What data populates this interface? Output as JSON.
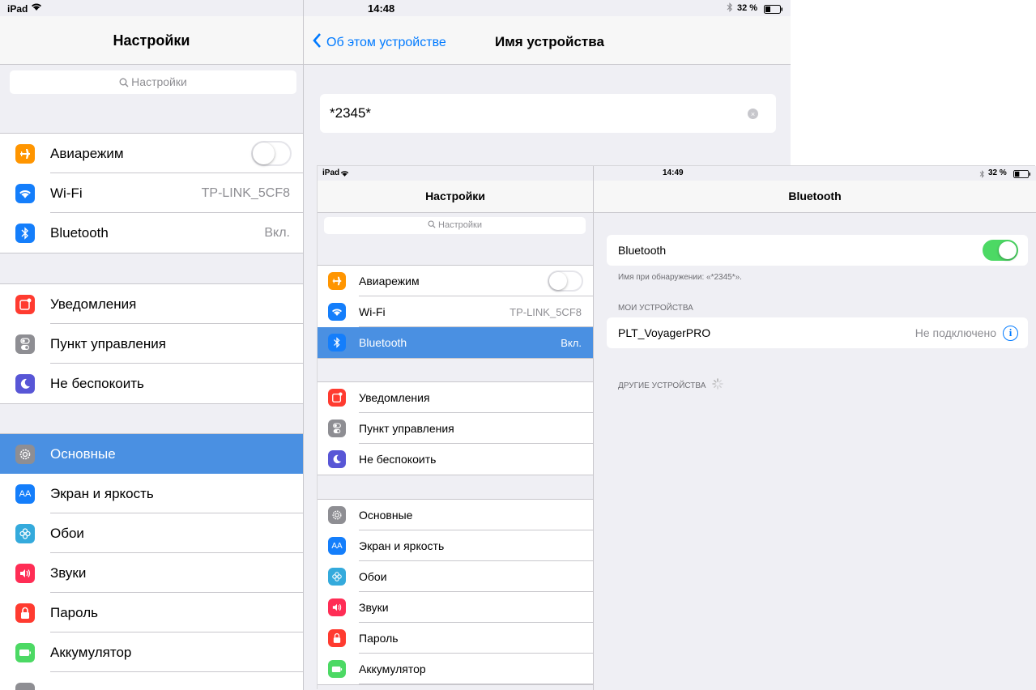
{
  "screenshot1": {
    "status": {
      "device": "iPad",
      "time": "14:48",
      "battery": "32 %"
    },
    "sidebar": {
      "title": "Настройки",
      "search_placeholder": "Настройки",
      "group1": [
        {
          "label": "Авиарежим",
          "value": "",
          "icon": "airplane-icon",
          "color": "#ff9500"
        },
        {
          "label": "Wi-Fi",
          "value": "TP-LINK_5CF8",
          "icon": "wifi-icon",
          "color": "#147efb"
        },
        {
          "label": "Bluetooth",
          "value": "Вкл.",
          "icon": "bluetooth-icon",
          "color": "#147efb"
        }
      ],
      "group2": [
        {
          "label": "Уведомления",
          "icon": "notifications-icon",
          "color": "#ff3b30"
        },
        {
          "label": "Пункт управления",
          "icon": "control-center-icon",
          "color": "#8e8e93"
        },
        {
          "label": "Не беспокоить",
          "icon": "moon-icon",
          "color": "#5856d6"
        }
      ],
      "group3": [
        {
          "label": "Основные",
          "icon": "gear-icon",
          "color": "#8e8e93",
          "selected": true
        },
        {
          "label": "Экран и яркость",
          "icon": "display-icon",
          "color": "#147efb"
        },
        {
          "label": "Обои",
          "icon": "wallpaper-icon",
          "color": "#34aadc"
        },
        {
          "label": "Звуки",
          "icon": "sound-icon",
          "color": "#ff2d55"
        },
        {
          "label": "Пароль",
          "icon": "lock-icon",
          "color": "#ff3b30"
        },
        {
          "label": "Аккумулятор",
          "icon": "battery-icon",
          "color": "#4cd964"
        }
      ]
    },
    "detail": {
      "back_label": "Об этом устройстве",
      "title": "Имя устройства",
      "device_name_value": "*2345*"
    }
  },
  "screenshot2": {
    "status": {
      "device": "iPad",
      "time": "14:49",
      "battery": "32 %"
    },
    "sidebar": {
      "title": "Настройки",
      "search_placeholder": "Настройки",
      "group1": [
        {
          "label": "Авиарежим",
          "value": "",
          "icon": "airplane-icon",
          "color": "#ff9500"
        },
        {
          "label": "Wi-Fi",
          "value": "TP-LINK_5CF8",
          "icon": "wifi-icon",
          "color": "#147efb"
        },
        {
          "label": "Bluetooth",
          "value": "Вкл.",
          "icon": "bluetooth-icon",
          "color": "#147efb",
          "selected": true
        }
      ],
      "group2": [
        {
          "label": "Уведомления",
          "icon": "notifications-icon",
          "color": "#ff3b30"
        },
        {
          "label": "Пункт управления",
          "icon": "control-center-icon",
          "color": "#8e8e93"
        },
        {
          "label": "Не беспокоить",
          "icon": "moon-icon",
          "color": "#5856d6"
        }
      ],
      "group3": [
        {
          "label": "Основные",
          "icon": "gear-icon",
          "color": "#8e8e93"
        },
        {
          "label": "Экран и яркость",
          "icon": "display-icon",
          "color": "#147efb"
        },
        {
          "label": "Обои",
          "icon": "wallpaper-icon",
          "color": "#34aadc"
        },
        {
          "label": "Звуки",
          "icon": "sound-icon",
          "color": "#ff2d55"
        },
        {
          "label": "Пароль",
          "icon": "lock-icon",
          "color": "#ff3b30"
        },
        {
          "label": "Аккумулятор",
          "icon": "battery-icon",
          "color": "#4cd964"
        }
      ]
    },
    "detail": {
      "title": "Bluetooth",
      "bluetooth_label": "Bluetooth",
      "bluetooth_on": true,
      "discoverable_caption": "Имя при обнаружении: «*2345*».",
      "my_devices_header": "МОИ УСТРОЙСТВА",
      "device_name": "PLT_VoyagerPRO",
      "device_status": "Не подключено",
      "other_devices_header": "ДРУГИЕ УСТРОЙСТВА"
    }
  },
  "colors": {
    "accent": "#007aff",
    "selection": "#4a90e2",
    "toggle_on": "#4cd964",
    "background": "#efeff4"
  }
}
